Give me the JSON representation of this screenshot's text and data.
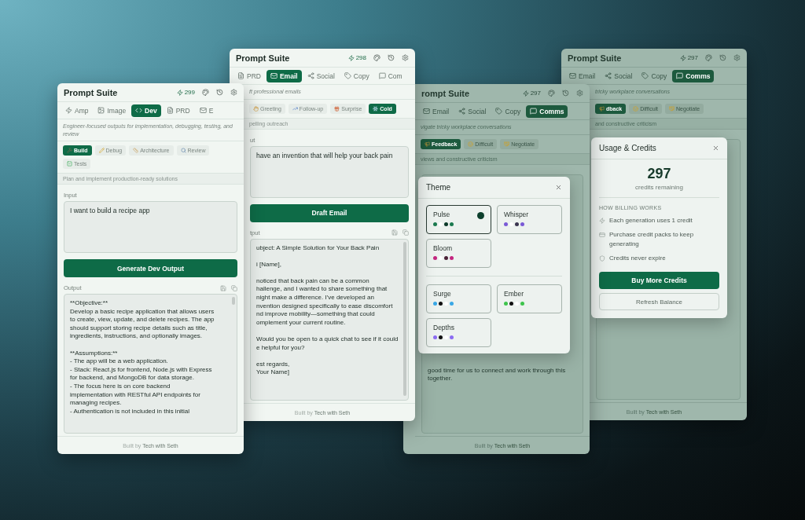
{
  "windows": [
    {
      "title": "Prompt Suite",
      "credits": "299",
      "dimmed": false,
      "tabs": [
        {
          "label": "Amp",
          "selected": false
        },
        {
          "label": "Image",
          "selected": false
        },
        {
          "label": "Dev",
          "selected": true
        },
        {
          "label": "PRD",
          "selected": false
        },
        {
          "label": "E",
          "selected": false
        }
      ],
      "description": "Engineer-focused outputs for implementation, debugging, testing, and review",
      "chips": [
        {
          "label": "Build",
          "selected": true
        },
        {
          "label": "Debug",
          "selected": false
        },
        {
          "label": "Architecture",
          "selected": false
        },
        {
          "label": "Review",
          "selected": false
        },
        {
          "label": "Tests",
          "selected": false
        }
      ],
      "hint": "Plan and implement production-ready solutions",
      "input": {
        "label": "Input",
        "value": "I want to build a recipe app"
      },
      "action": "Generate Dev Output",
      "output": {
        "label": "Output",
        "paragraphs": [
          [
            "**Objective:**",
            "Develop a basic recipe application that allows users",
            "to create, view, update, and delete recipes. The app",
            "should support storing recipe details such as title,",
            "ingredients, instructions, and optionally images."
          ],
          [
            "**Assumptions:**",
            "- The app will be a web application.",
            "- Stack: React.js for frontend, Node.js with Express",
            "for backend, and MongoDB for data storage.",
            "- The focus here is on core backend",
            "implementation with RESTful API endpoints for",
            "managing recipes.",
            "- Authentication is not included in this initial"
          ]
        ]
      },
      "footer": {
        "text": "Built by",
        "link": "Tech with Seth"
      }
    },
    {
      "title": "Prompt Suite",
      "credits": "298",
      "dimmed": false,
      "tabs": [
        {
          "label": "PRD",
          "selected": false
        },
        {
          "label": "Email",
          "selected": true
        },
        {
          "label": "Social",
          "selected": false
        },
        {
          "label": "Copy",
          "selected": false
        },
        {
          "label": "Com",
          "selected": false
        }
      ],
      "description": "ft professional emails",
      "chips": [
        {
          "label": "Greeting",
          "selected": false
        },
        {
          "label": "Follow-up",
          "selected": false
        },
        {
          "label": "Surprise",
          "selected": false
        },
        {
          "label": "Cold",
          "selected": true
        }
      ],
      "hint": "pelling outreach",
      "input": {
        "label": "ut",
        "value": "have an invention that will help your back pain"
      },
      "action": "Draft Email",
      "output": {
        "label": "tput",
        "paragraphs": [
          [
            "ubject: A Simple Solution for Your Back Pain"
          ],
          [
            "i [Name],"
          ],
          [
            "noticed that back pain can be a common",
            "hallenge, and I wanted to share something that",
            "night make a difference. I've developed an",
            "nvention designed specifically to ease discomfort",
            "nd improve mobility—something that could",
            "omplement your current routine."
          ],
          [
            "Would you be open to a quick chat to see if it could",
            "e helpful for you?"
          ],
          [
            "est regards,",
            "Your Name]"
          ]
        ]
      },
      "footer": {
        "text": "Built by",
        "link": "Tech with Seth"
      }
    },
    {
      "title": "rompt Suite",
      "credits": "297",
      "dimmed": true,
      "tabs": [
        {
          "label": "Email",
          "selected": false
        },
        {
          "label": "Social",
          "selected": false
        },
        {
          "label": "Copy",
          "selected": false
        },
        {
          "label": "Comms",
          "selected": true
        }
      ],
      "description": "vigate tricky workplace conversations",
      "chips": [
        {
          "label": "Feedback",
          "selected": true
        },
        {
          "label": "Difficult",
          "selected": false
        },
        {
          "label": "Negotiate",
          "selected": false
        }
      ],
      "hint": "views and constructive criticism",
      "output": {
        "paragraphs": [
          [
            "good time for us to connect and work through this",
            "together."
          ]
        ]
      },
      "footer": {
        "text": "Built by",
        "link": "Tech with Seth"
      },
      "modal": {
        "kind": "theme",
        "title": "Theme",
        "groups": [
          [
            {
              "name": "Pulse",
              "selected": true,
              "colors": [
                {
                  "color": "#1b7a4f"
                },
                {
                  "color": "#ffffff"
                },
                {
                  "color": "#0d3a2a"
                },
                {
                  "color": "#1b7a4f"
                }
              ]
            },
            {
              "name": "Whisper",
              "selected": false,
              "colors": [
                {
                  "color": "#7a5ad6"
                },
                {
                  "color": "#ffffff"
                },
                {
                  "color": "#3b3550"
                },
                {
                  "color": "#7a5ad6"
                }
              ]
            },
            {
              "name": "Bloom",
              "selected": false,
              "colors": [
                {
                  "color": "#c42680"
                },
                {
                  "color": "#ffffff"
                },
                {
                  "color": "#4a2236"
                },
                {
                  "color": "#c42680"
                }
              ]
            }
          ],
          [
            {
              "name": "Surge",
              "selected": false,
              "colors": [
                {
                  "color": "#3aa8e6"
                },
                {
                  "color": "#111111"
                },
                {
                  "color": "#ffffff"
                },
                {
                  "color": "#3aa8e6"
                }
              ]
            },
            {
              "name": "Ember",
              "selected": false,
              "colors": [
                {
                  "color": "#3ec44c"
                },
                {
                  "color": "#111111"
                },
                {
                  "color": "#ffffff"
                },
                {
                  "color": "#3ec44c"
                }
              ]
            },
            {
              "name": "Depths",
              "selected": false,
              "colors": [
                {
                  "color": "#8c6cf2"
                },
                {
                  "color": "#111111"
                },
                {
                  "color": "#ffffff"
                },
                {
                  "color": "#8c6cf2"
                }
              ]
            }
          ]
        ]
      }
    },
    {
      "title": "Prompt Suite",
      "credits": "297",
      "dimmed": true,
      "tabs": [
        {
          "label": "Email",
          "selected": false
        },
        {
          "label": "Social",
          "selected": false
        },
        {
          "label": "Copy",
          "selected": false
        },
        {
          "label": "Comms",
          "selected": true
        }
      ],
      "description": "tricky workplace conversations",
      "chips": [
        {
          "label": "dback",
          "selected": true
        },
        {
          "label": "Difficult",
          "selected": false
        },
        {
          "label": "Negotiate",
          "selected": false
        }
      ],
      "hint": "and constructive criticism",
      "footer": {
        "text": "Built by",
        "link": "Tech with Seth"
      },
      "modal": {
        "kind": "credits",
        "title": "Usage & Credits",
        "count": "297",
        "count_label": "credits remaining",
        "section": "HOW BILLING WORKS",
        "items": [
          "Each generation uses 1 credit",
          "Purchase credit packs to keep generating",
          "Credits never expire"
        ],
        "primary": "Buy More Credits",
        "secondary": "Refresh Balance"
      }
    }
  ]
}
